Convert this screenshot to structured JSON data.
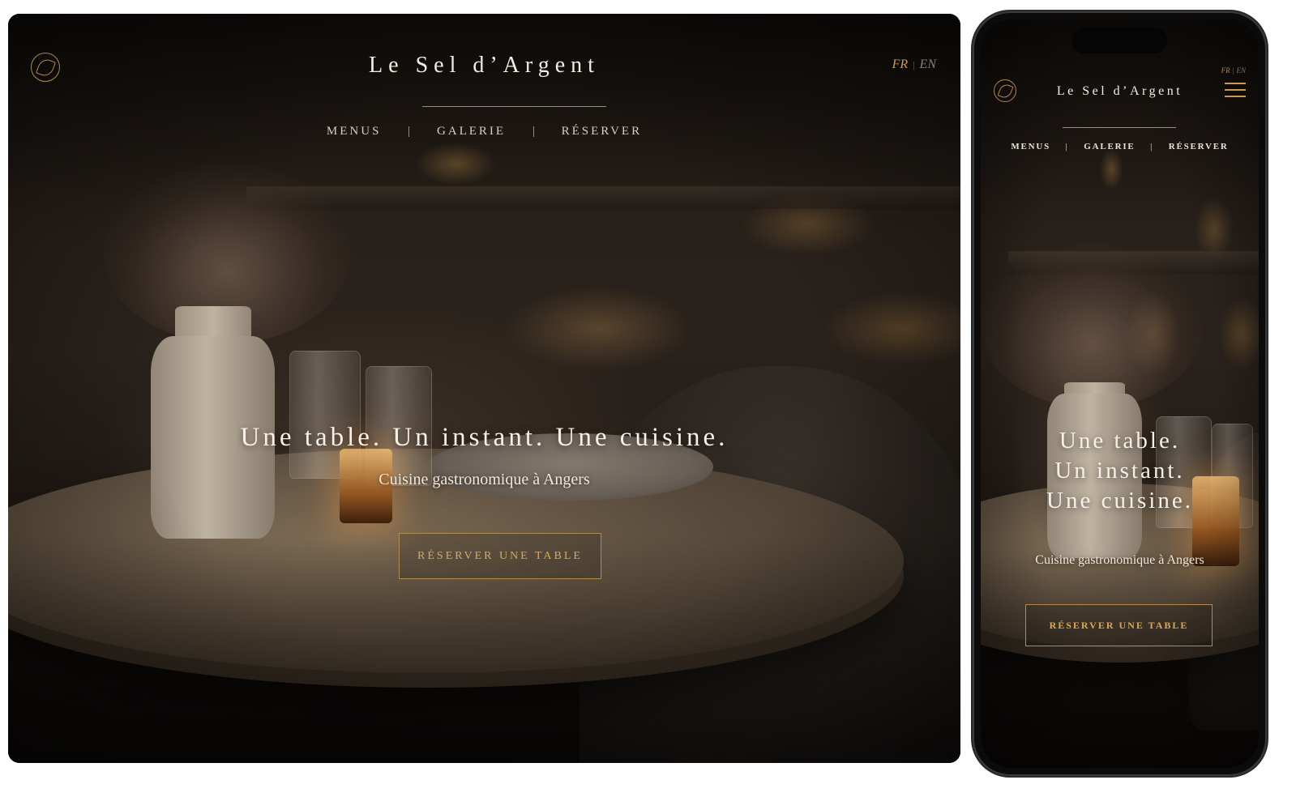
{
  "brand": {
    "name": "Le Sel d’Argent",
    "logo_icon": "leaf-monogram-icon",
    "accent_color": "#b08a4e",
    "cta_text_color": "#d9a85c"
  },
  "language_switch": {
    "active": "FR",
    "separator": "|",
    "other": "EN"
  },
  "nav": {
    "separator": "|",
    "items": [
      {
        "label": "MENUS"
      },
      {
        "label": "GALERIE"
      },
      {
        "label": "RÉSERVER"
      }
    ]
  },
  "hero": {
    "headline": "Une table. Un instant. Une cuisine.",
    "headline_lines": [
      "Une table.",
      "Un instant.",
      "Une cuisine."
    ],
    "subtitle": "Cuisine gastronomique à Angers",
    "cta_label": "RÉSERVER UNE TABLE"
  },
  "mobile": {
    "menu_icon": "hamburger-menu-icon"
  }
}
